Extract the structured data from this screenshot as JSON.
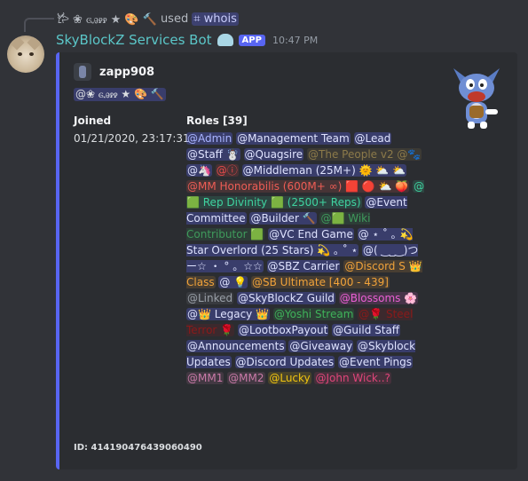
{
  "reply": {
    "user": "𐂂 ❀ ꮆꭿꭾꭾ ★ 🎨 🔨",
    "used_text": "used",
    "command": "⌗ whois"
  },
  "message": {
    "bot_name": "SkyBlockZ Services Bot",
    "app_badge": "APP",
    "timestamp": "10:47 PM"
  },
  "embed": {
    "accent_color": "#5865f2",
    "author_name": "zapp908",
    "description": "@❀ ꮆꭿꭾꭾ ★ 🎨 🔨",
    "fields": {
      "joined_name": "Joined",
      "joined_value": "01/21/2020, 23:17:31",
      "roles_name": "Roles [39]"
    },
    "roles": [
      {
        "text": "@Admin",
        "color": "#a9b4ff",
        "bg": "rgba(88,101,242,0.30)"
      },
      {
        "text": "@Management Team",
        "color": "#dfe3ff",
        "bg": "rgba(88,101,242,0.30)"
      },
      {
        "text": "@Lead",
        "color": "#dfe3ff",
        "bg": "rgba(88,101,242,0.30)"
      },
      {
        "text": "@Staff ☃️",
        "color": "#dfe3ff",
        "bg": "rgba(88,101,242,0.30)"
      },
      {
        "text": "@Quagsire",
        "color": "#dfe3ff",
        "bg": "rgba(88,101,242,0.30)"
      },
      {
        "text": "@The People v2 @🐾",
        "color": "#8c7a4a",
        "bg": "rgba(140,122,74,0.18)"
      },
      {
        "text": "@🦄",
        "color": "#dfe3ff",
        "bg": "rgba(88,101,242,0.30)"
      },
      {
        "text": "@ⓘ",
        "color": "#e84b4b",
        "bg": "rgba(232,75,75,0.15)"
      },
      {
        "text": "@Middleman (25M+) 🌞 ⛅ ⛅",
        "color": "#dfe3ff",
        "bg": "rgba(88,101,242,0.30)"
      },
      {
        "text": "@MM Honorabilis (600M+ ∞) 🟥 🔴 ⛅ 🍑",
        "color": "#ee5d55",
        "bg": "rgba(238,93,85,0.15)"
      },
      {
        "text": "@🟩 Rep Divinity 🟩 (2500+ Reps)",
        "color": "#3fd3a0",
        "bg": "rgba(63,211,160,0.15)"
      },
      {
        "text": "@Event Committee",
        "color": "#dfe3ff",
        "bg": "rgba(88,101,242,0.30)"
      },
      {
        "text": "@Builder 🔨",
        "color": "#dfe3ff",
        "bg": "rgba(88,101,242,0.30)"
      },
      {
        "text": "@🟩 Wiki Contributor 🟩",
        "color": "#3f9a5c",
        "bg": "rgba(63,154,92,0.15)"
      },
      {
        "text": "@VC End Game",
        "color": "#dfe3ff",
        "bg": "rgba(88,101,242,0.30)"
      },
      {
        "text": "@ ⋆ ˚ ｡ 💫 Star Overlord (25 Stars) 💫 ｡ ˚ ⋆",
        "color": "#dfe3ff",
        "bg": "rgba(88,101,242,0.30)"
      },
      {
        "text": "@( ‿_‿)つー☆ ・ ° 。☆☆",
        "color": "#dfe3ff",
        "bg": "rgba(88,101,242,0.30)"
      },
      {
        "text": "@SBZ Carrier",
        "color": "#dfe3ff",
        "bg": "rgba(88,101,242,0.30)"
      },
      {
        "text": "@Discord S 👑 Class",
        "color": "#f0a23a",
        "bg": "rgba(240,162,58,0.15)"
      },
      {
        "text": "@ 💡",
        "color": "#dfe3ff",
        "bg": "rgba(88,101,242,0.30)"
      },
      {
        "text": "@SB Ultimate [400 - 439]",
        "color": "#f0a23a",
        "bg": "rgba(240,162,58,0.15)"
      },
      {
        "text": "@Linked",
        "color": "#9aa0a8",
        "bg": "rgba(154,160,168,0.12)"
      },
      {
        "text": "@SkyBlockZ Guild",
        "color": "#dfe3ff",
        "bg": "rgba(88,101,242,0.30)"
      },
      {
        "text": "@Blossoms 🌸",
        "color": "#ea5fd4",
        "bg": "rgba(234,95,212,0.15)"
      },
      {
        "text": "@👑 Legacy 👑",
        "color": "#dfe3ff",
        "bg": "rgba(88,101,242,0.30)"
      },
      {
        "text": "@Yoshi Stream",
        "color": "#3fb35a",
        "bg": "rgba(63,179,90,0.15)"
      },
      {
        "text": "@🌹 Steel Terror 🌹",
        "color": "#8a1a1a",
        "bg": "rgba(138,26,26,0.18)"
      },
      {
        "text": "@LootboxPayout",
        "color": "#dfe3ff",
        "bg": "rgba(88,101,242,0.30)"
      },
      {
        "text": "@Guild Staff",
        "color": "#dfe3ff",
        "bg": "rgba(88,101,242,0.30)"
      },
      {
        "text": "@Announcements",
        "color": "#dfe3ff",
        "bg": "rgba(88,101,242,0.30)"
      },
      {
        "text": "@Giveaway",
        "color": "#dfe3ff",
        "bg": "rgba(88,101,242,0.30)"
      },
      {
        "text": "@Skyblock Updates",
        "color": "#dfe3ff",
        "bg": "rgba(88,101,242,0.30)"
      },
      {
        "text": "@Discord Updates",
        "color": "#dfe3ff",
        "bg": "rgba(88,101,242,0.30)"
      },
      {
        "text": "@Event Pings",
        "color": "#dfe3ff",
        "bg": "rgba(88,101,242,0.30)"
      },
      {
        "text": "@MM1",
        "color": "#c97aa8",
        "bg": "rgba(201,122,168,0.15)"
      },
      {
        "text": "@MM2",
        "color": "#c97aa8",
        "bg": "rgba(201,122,168,0.15)"
      },
      {
        "text": "@Lucky",
        "color": "#f1c40f",
        "bg": "rgba(241,196,15,0.15)"
      },
      {
        "text": "@John Wick..?",
        "color": "#e0457a",
        "bg": "rgba(224,69,122,0.15)"
      }
    ],
    "footer": "ID: 414190476439060490"
  }
}
